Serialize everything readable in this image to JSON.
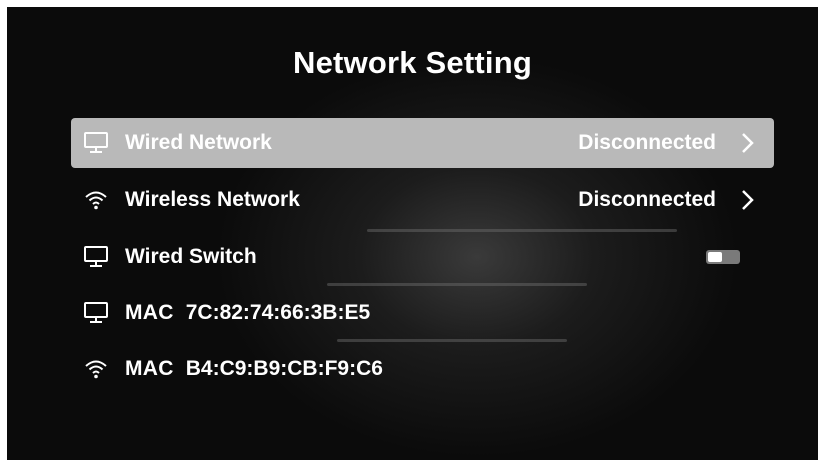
{
  "title": "Network Setting",
  "rows": [
    {
      "icon": "monitor-icon",
      "label": "Wired Network",
      "status": "Disconnected",
      "selected": true
    },
    {
      "icon": "wifi-icon",
      "label": "Wireless Network",
      "status": "Disconnected",
      "selected": false
    },
    {
      "icon": "monitor-icon",
      "label": "Wired Switch",
      "toggle_on": false
    },
    {
      "icon": "monitor-icon",
      "mac_label": "MAC",
      "mac_value": "7C:82:74:66:3B:E5"
    },
    {
      "icon": "wifi-icon",
      "mac_label": "MAC",
      "mac_value": "B4:C9:B9:CB:F9:C6"
    }
  ],
  "colors": {
    "background": "#0b0b0b",
    "selected_row": "#b9b9b9",
    "text": "#ffffff",
    "toggle_track": "#7a7a7a"
  }
}
